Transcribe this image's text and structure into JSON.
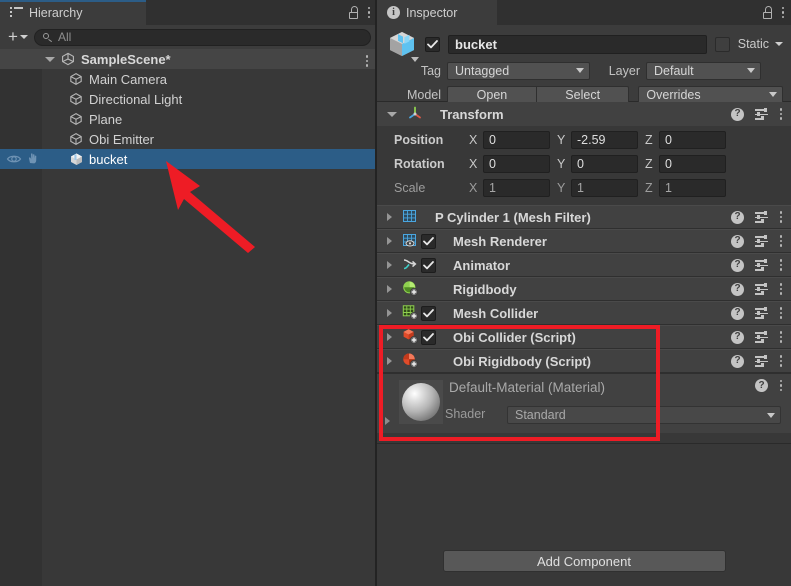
{
  "hierarchy": {
    "tab": {
      "label": "Hierarchy",
      "icon": "list-icon",
      "lock_icon": "lock-icon",
      "menu_icon": "kebab-menu-icon"
    },
    "toolbar": {
      "add_label": "+",
      "add_icon": "plus-icon",
      "dropdown_icon": "chevron-down-icon"
    },
    "search": {
      "value": "All",
      "placeholder": "All",
      "icon": "search-icon"
    },
    "scene": {
      "label": "SampleScene*",
      "icon": "scene-icon",
      "expanded": true,
      "menu_icon": "kebab-menu-icon"
    },
    "items": [
      {
        "label": "Main Camera",
        "icon": "gameobject-cube-icon",
        "selected": false
      },
      {
        "label": "Directional Light",
        "icon": "gameobject-cube-icon",
        "selected": false
      },
      {
        "label": "Plane",
        "icon": "gameobject-cube-icon",
        "selected": false
      },
      {
        "label": "Obi Emitter",
        "icon": "gameobject-cube-icon",
        "selected": false
      },
      {
        "label": "bucket",
        "icon": "prefab-cube-icon",
        "selected": true,
        "visibility_icon": "eye-icon",
        "pickability_icon": "hand-icon"
      }
    ]
  },
  "inspector": {
    "tab": {
      "label": "Inspector",
      "icon": "info-icon",
      "lock_icon": "lock-icon",
      "menu_icon": "kebab-menu-icon"
    },
    "object": {
      "icon": "prefab-cube-icon",
      "enabled": true,
      "name": "bucket",
      "static_label": "Static",
      "static_checked": false,
      "static_dropdown_icon": "chevron-down-icon",
      "tag_label": "Tag",
      "tag_value": "Untagged",
      "layer_label": "Layer",
      "layer_value": "Default",
      "model_label": "Model",
      "model_open_label": "Open",
      "model_select_label": "Select",
      "overrides_label": "Overrides"
    },
    "transform": {
      "title": "Transform",
      "icon": "transform-axes-icon",
      "expanded": true,
      "rows": [
        {
          "label": "Position",
          "x": "0",
          "y": "-2.59",
          "z": "0",
          "dim": false
        },
        {
          "label": "Rotation",
          "x": "0",
          "y": "0",
          "z": "0",
          "dim": false
        },
        {
          "label": "Scale",
          "x": "1",
          "y": "1",
          "z": "1",
          "dim": true
        }
      ],
      "axis_labels": [
        "X",
        "Y",
        "Z"
      ]
    },
    "components": [
      {
        "title": "P Cylinder 1 (Mesh Filter)",
        "icon": "mesh-filter-icon",
        "has_checkbox": false,
        "checked": false,
        "highlighted": false
      },
      {
        "title": "Mesh Renderer",
        "icon": "mesh-renderer-icon",
        "has_checkbox": true,
        "checked": true,
        "highlighted": false
      },
      {
        "title": "Animator",
        "icon": "animator-icon",
        "has_checkbox": true,
        "checked": true,
        "highlighted": false
      },
      {
        "title": "Rigidbody",
        "icon": "rigidbody-icon",
        "has_checkbox": false,
        "checked": false,
        "highlighted": true
      },
      {
        "title": "Mesh Collider",
        "icon": "mesh-collider-icon",
        "has_checkbox": true,
        "checked": true,
        "highlighted": true
      },
      {
        "title": "Obi Collider (Script)",
        "icon": "obi-collider-icon",
        "has_checkbox": true,
        "checked": true,
        "highlighted": true
      },
      {
        "title": "Obi Rigidbody (Script)",
        "icon": "obi-rigidbody-icon",
        "has_checkbox": false,
        "checked": false,
        "highlighted": true
      }
    ],
    "row_icons": {
      "help_icon": "help-icon",
      "preset_icon": "preset-icon",
      "menu_icon": "kebab-menu-icon"
    },
    "material": {
      "title": "Default-Material (Material)",
      "preview_icon": "material-sphere-preview",
      "shader_label": "Shader",
      "shader_value": "Standard",
      "shader_dropdown_icon": "chevron-down-icon"
    },
    "add_component_label": "Add Component"
  },
  "annotations": {
    "highlight_box_color": "#ee1c25",
    "arrow_color": "#ee1c25",
    "arrow_name": "red-pointer-arrow",
    "highlight_name": "red-highlight-box"
  },
  "colors": {
    "panel_bg": "#383838",
    "header_bg": "#3c3c3c",
    "row_bg": "#414141",
    "selection_blue": "#2c5d87",
    "accent_blue": "#2d7bbd",
    "text": "#c8c8c8"
  }
}
